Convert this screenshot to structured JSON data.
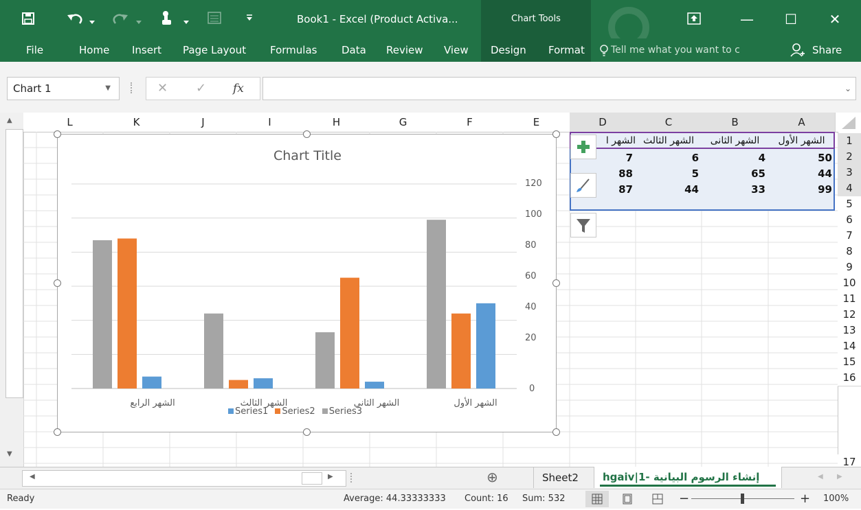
{
  "titlebar": {
    "title": "Book1 - Excel (Product Activa...",
    "context_label": "Chart Tools",
    "save_icon": "save-icon",
    "undo_icon": "undo-icon",
    "redo_icon": "redo-icon",
    "touch_icon": "touch-mode-icon",
    "form_icon": "form-icon",
    "customize_icon": "customize-qat-icon",
    "ribbon_display_icon": "ribbon-display-icon",
    "minimize_glyph": "—",
    "maximize_glyph": "☐",
    "close_glyph": "✕"
  },
  "ribbon": {
    "tabs": [
      "File",
      "Home",
      "Insert",
      "Page Layout",
      "Formulas",
      "Data",
      "Review",
      "View",
      "Design",
      "Format"
    ],
    "tell_me": "Tell me what you want to c",
    "share": "Share"
  },
  "formula_bar": {
    "name_box": "Chart 1",
    "cancel_glyph": "✕",
    "enter_glyph": "✓",
    "fx_label": "fx",
    "formula": ""
  },
  "grid": {
    "columns": [
      "L",
      "K",
      "J",
      "I",
      "H",
      "G",
      "F",
      "E",
      "D",
      "C",
      "B",
      "A"
    ],
    "rows": [
      "1",
      "2",
      "3",
      "4",
      "5",
      "6",
      "7",
      "8",
      "9",
      "10",
      "11",
      "12",
      "13",
      "14",
      "15",
      "16",
      "17"
    ],
    "header_row": {
      "A": "الشهر الأول",
      "B": "الشهر الثانى",
      "C": "الشهر الثالث",
      "D": "الشهر ا"
    },
    "data": [
      {
        "A": "50",
        "B": "4",
        "C": "6",
        "D": "7"
      },
      {
        "A": "44",
        "B": "65",
        "C": "5",
        "D": "88"
      },
      {
        "A": "99",
        "B": "33",
        "C": "44",
        "D": "87"
      }
    ]
  },
  "chart_side_buttons": [
    "chart-elements-icon",
    "chart-styles-icon",
    "chart-filters-icon"
  ],
  "chart_data": {
    "type": "bar",
    "title": "Chart Title",
    "categories": [
      "الشهر الأول",
      "الشهر الثاني",
      "الشهر الثالث",
      "الشهر الرابع"
    ],
    "series": [
      {
        "name": "Series1",
        "values": [
          50,
          4,
          6,
          7
        ],
        "color": "#5b9bd5"
      },
      {
        "name": "Series2",
        "values": [
          44,
          65,
          5,
          88
        ],
        "color": "#ed7d31"
      },
      {
        "name": "Series3",
        "values": [
          99,
          33,
          44,
          87
        ],
        "color": "#a5a5a5"
      }
    ],
    "yticks": [
      "0",
      "20",
      "40",
      "60",
      "80",
      "100",
      "120"
    ],
    "ylim": [
      0,
      120
    ],
    "y_axis_side": "right",
    "x_order": "right-to-left",
    "grid": true,
    "legend": "bottom"
  },
  "sheets": {
    "tabs": [
      "Sheet2",
      "hgaiv|إنشاء الرسوم البيانية -1"
    ],
    "active": 1,
    "add_glyph": "⊕"
  },
  "status": {
    "ready": "Ready",
    "average": "Average: 44.33333333",
    "count": "Count: 16",
    "sum": "Sum: 532",
    "zoom": "100%",
    "zoom_minus": "−",
    "zoom_plus": "+"
  },
  "colors": {
    "brand": "#217346",
    "brand_dark": "#1b5e3a",
    "selection": "#dce6f2"
  }
}
